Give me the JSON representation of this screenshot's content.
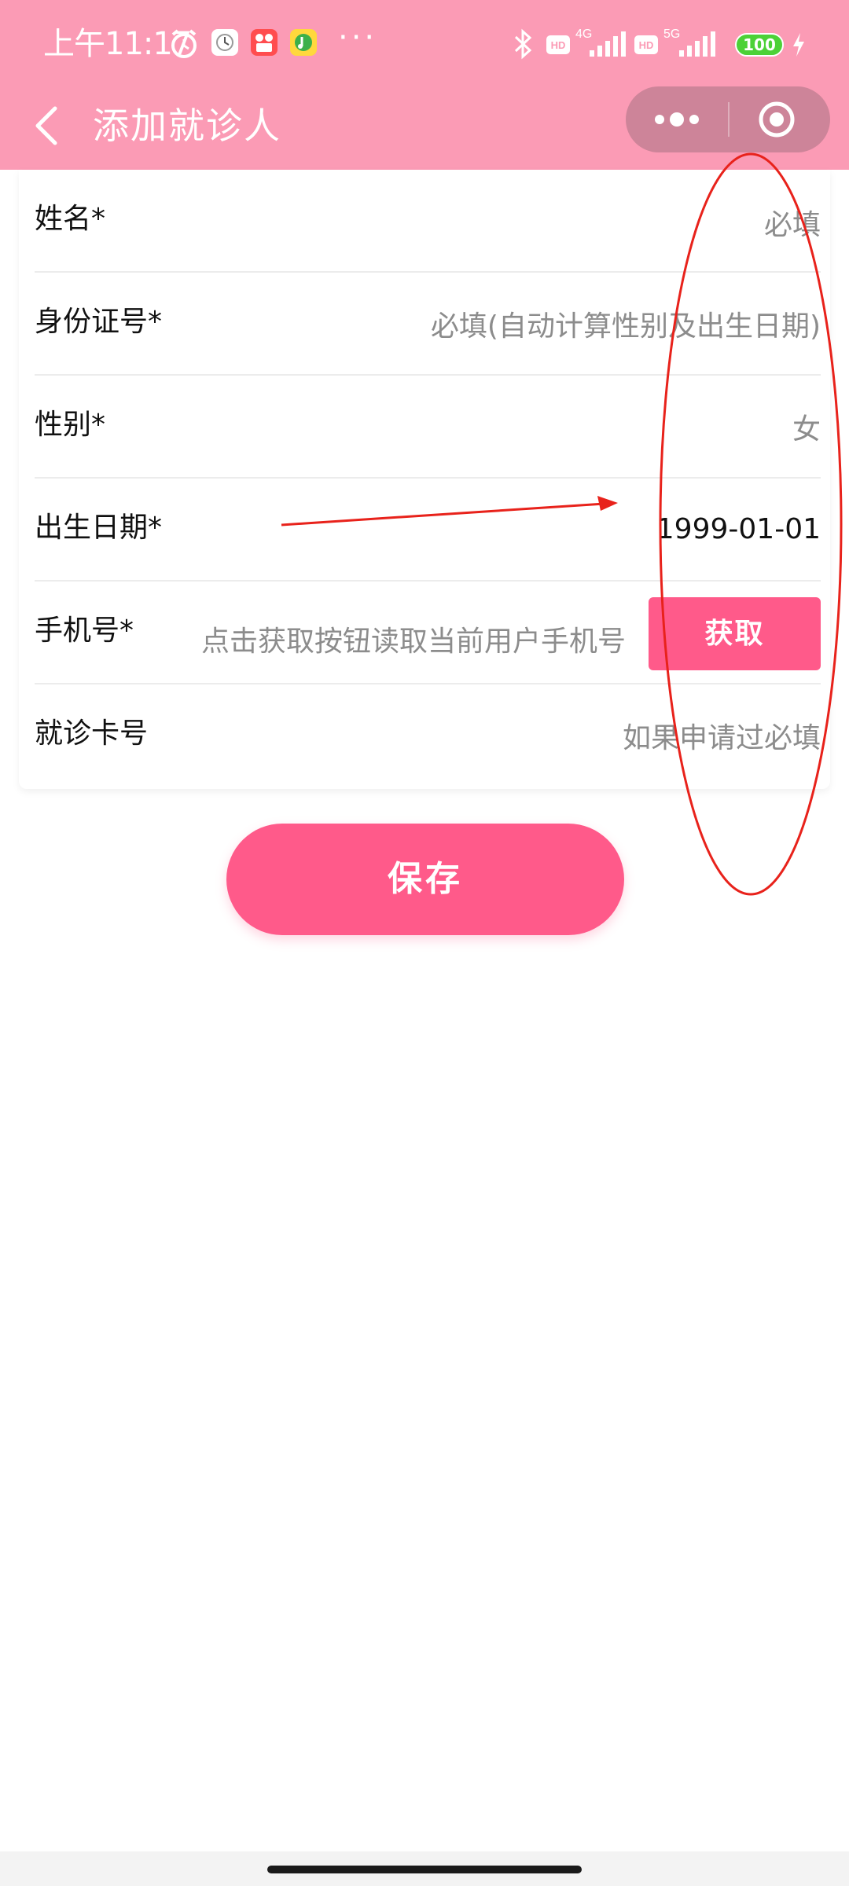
{
  "status_bar": {
    "time": "上午11:17",
    "more_dots": "···",
    "battery": "100",
    "icons": [
      "alarm-icon",
      "clock-app-icon",
      "video-app-icon",
      "music-app-icon",
      "bluetooth-icon",
      "hd-icon",
      "signal-4g-icon",
      "hd-icon",
      "signal-5g-icon",
      "battery-icon",
      "charging-icon"
    ]
  },
  "nav": {
    "title": "添加就诊人",
    "back_icon": "chevron-left-icon",
    "more_icon": "more-dots-icon",
    "close_icon": "target-close-icon"
  },
  "form": {
    "rows": [
      {
        "label": "姓名*",
        "value": "必填",
        "state": "placeholder"
      },
      {
        "label": "身份证号*",
        "value": "必填(自动计算性别及出生日期)",
        "state": "placeholder"
      },
      {
        "label": "性别*",
        "value": "女",
        "state": "placeholder"
      },
      {
        "label": "出生日期*",
        "value": "1999-01-01",
        "state": "filled"
      },
      {
        "label": "手机号*",
        "value": "点击获取按钮读取当前用户手机号",
        "state": "placeholder"
      },
      {
        "label": "就诊卡号",
        "value": "如果申请过必填",
        "state": "placeholder"
      }
    ],
    "get_button": "获取"
  },
  "save_button": "保存",
  "colors": {
    "header_bg": "#fb9bb5",
    "accent": "#ff5a8a",
    "placeholder": "#8c8c8c",
    "annotation": "#e8221b"
  }
}
